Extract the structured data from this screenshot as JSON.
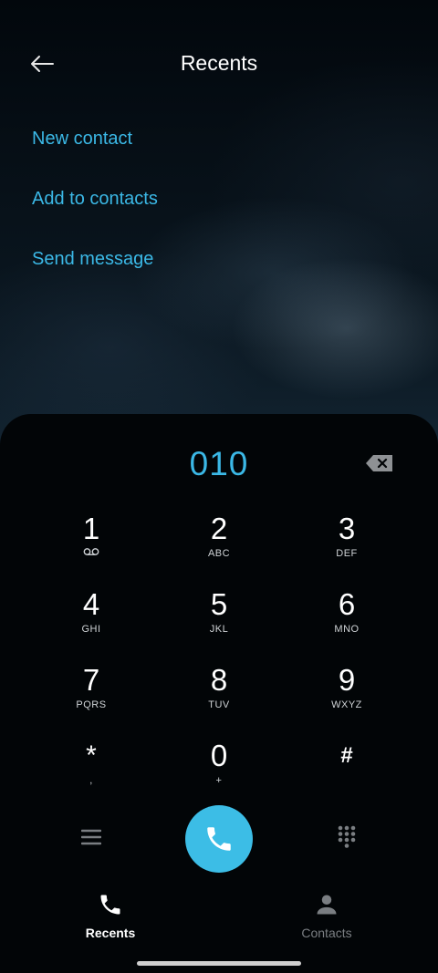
{
  "header": {
    "title": "Recents"
  },
  "actions": {
    "new_contact": "New contact",
    "add_to_contacts": "Add to contacts",
    "send_message": "Send message"
  },
  "dialer": {
    "number": "010",
    "keys": [
      {
        "digit": "1",
        "letters": "voicemail-icon"
      },
      {
        "digit": "2",
        "letters": "ABC"
      },
      {
        "digit": "3",
        "letters": "DEF"
      },
      {
        "digit": "4",
        "letters": "GHI"
      },
      {
        "digit": "5",
        "letters": "JKL"
      },
      {
        "digit": "6",
        "letters": "MNO"
      },
      {
        "digit": "7",
        "letters": "PQRS"
      },
      {
        "digit": "8",
        "letters": "TUV"
      },
      {
        "digit": "9",
        "letters": "WXYZ"
      },
      {
        "digit": "*",
        "letters": ","
      },
      {
        "digit": "0",
        "letters": "+"
      },
      {
        "digit": "#",
        "letters": ""
      }
    ]
  },
  "bottom_nav": {
    "recents": "Recents",
    "contacts": "Contacts"
  },
  "colors": {
    "accent": "#3bb8e6",
    "call_button": "#3cbde6",
    "background": "#000000"
  },
  "icons": {
    "back": "arrow-left-icon",
    "backspace": "backspace-icon",
    "menu": "hamburger-menu-icon",
    "call": "phone-icon",
    "keypad": "dialpad-grid-icon",
    "recents": "phone-icon",
    "contacts": "person-icon"
  }
}
